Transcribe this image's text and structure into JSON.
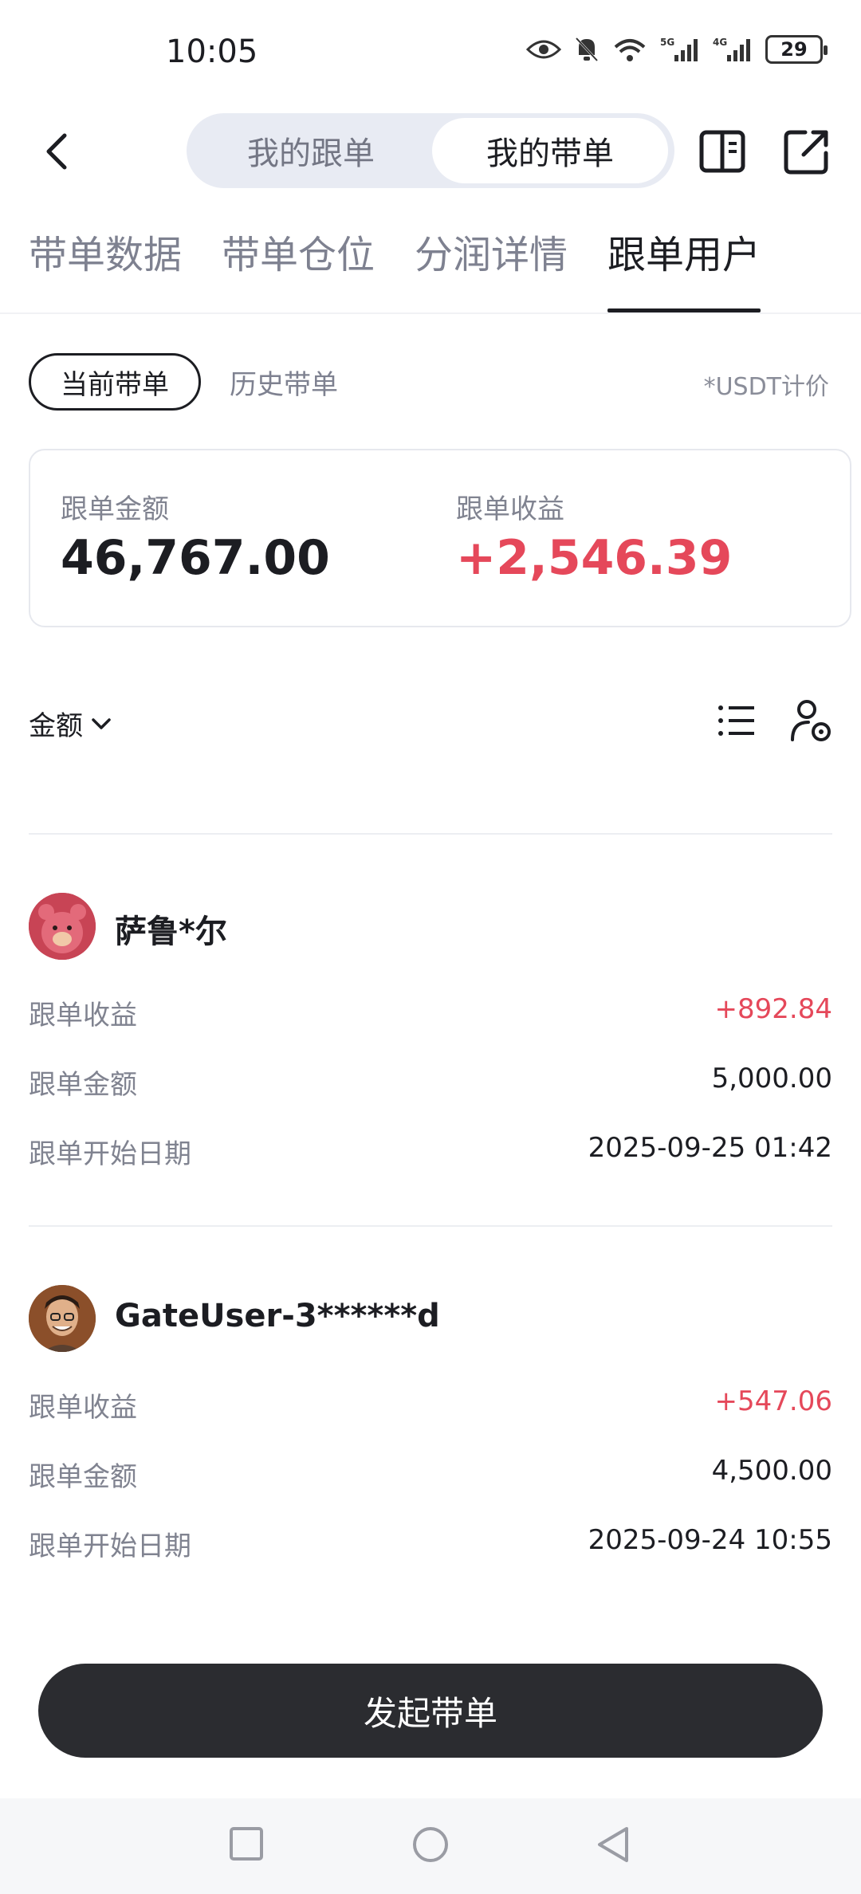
{
  "status": {
    "time": "10:05",
    "battery": "29"
  },
  "header": {
    "seg_left": "我的跟单",
    "seg_right": "我的带单"
  },
  "tabs": [
    {
      "label": "带单数据"
    },
    {
      "label": "带单仓位"
    },
    {
      "label": "分润详情"
    },
    {
      "label": "跟单用户"
    }
  ],
  "subtabs": {
    "current": "当前带单",
    "history": "历史带单",
    "pricing_note": "*USDT计价"
  },
  "summary": {
    "amount_label": "跟单金额",
    "amount_value": "46,767.00",
    "profit_label": "跟单收益",
    "profit_value": "+2,546.39"
  },
  "filter": {
    "sort_label": "金额"
  },
  "users": [
    {
      "name": "萨鲁*尔",
      "profit_label": "跟单收益",
      "profit": "+892.84",
      "amount_label": "跟单金额",
      "amount": "5,000.00",
      "start_label": "跟单开始日期",
      "start": "2025-09-25 01:42"
    },
    {
      "name": "GateUser-3******d",
      "profit_label": "跟单收益",
      "profit": "+547.06",
      "amount_label": "跟单金额",
      "amount": "4,500.00",
      "start_label": "跟单开始日期",
      "start": "2025-09-24 10:55"
    }
  ],
  "cta": {
    "label": "发起带单"
  },
  "colors": {
    "accent_red": "#e5485a",
    "cta_bg": "#2b2c30",
    "segment_bg": "#e8ebf3"
  }
}
